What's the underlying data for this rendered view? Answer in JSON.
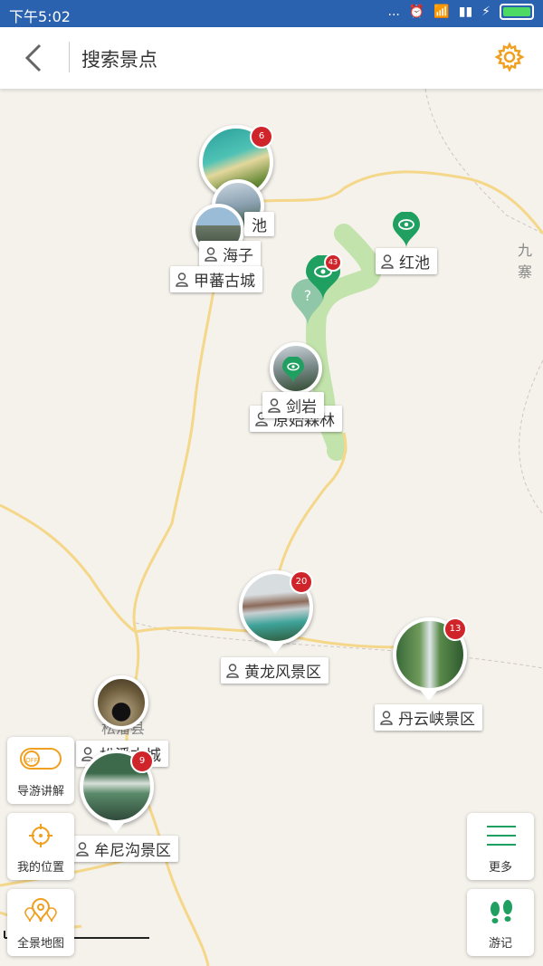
{
  "status_bar": {
    "time": "下午5:02",
    "signal_dots": "..."
  },
  "header": {
    "title": "搜索景点"
  },
  "map": {
    "place_labels": {
      "jiuzhai": "九寨",
      "songpan_county": "松潘县"
    },
    "clusters": {
      "top": {
        "count": "6"
      },
      "huanglong": {
        "count": "20"
      },
      "danyun": {
        "count": "13"
      },
      "mounigou": {
        "count": "9"
      },
      "pin_count": "43"
    },
    "spots": {
      "chi_partial": "池",
      "haizi_partial": "海子",
      "jiafan_gucheng": "甲蕃古城",
      "hongchi": "红池",
      "jianyan": "剑岩",
      "yuanshi_senlin": "原始森林",
      "huanglong_scenic": "黄龙风景区",
      "danyun_gorge": "丹云峡景区",
      "songpan_gucheng": "松潘古城",
      "mounigou_scenic": "牟尼沟景区"
    }
  },
  "controls": {
    "guide_toggle": {
      "state": "OFF",
      "label": "导游讲解"
    },
    "my_location": {
      "label": "我的位置"
    },
    "panorama_map": {
      "label": "全景地图"
    },
    "more": {
      "label": "更多"
    },
    "travel_notes": {
      "label": "游记"
    }
  },
  "colors": {
    "status_bar": "#2b62b0",
    "accent": "#f0a020",
    "pin_green": "#1fa060",
    "badge_red": "#d0242b",
    "road": "#f5d78a",
    "route": "#b8e0a0"
  }
}
